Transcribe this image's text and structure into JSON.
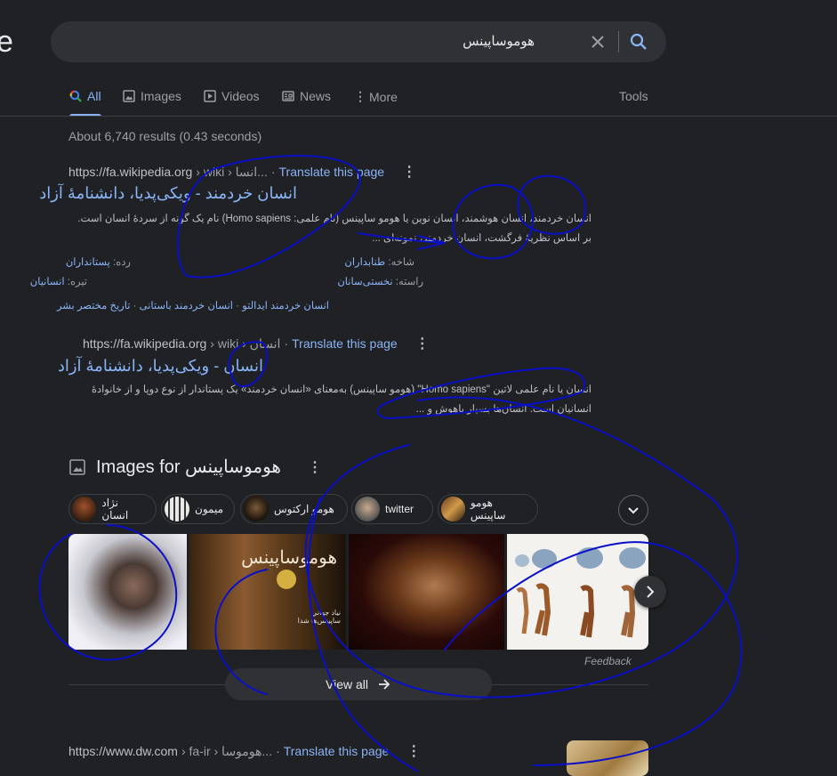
{
  "logo_fragment": "e",
  "search": {
    "query": "هوموساپینس",
    "clear_icon": "close-icon",
    "search_icon": "search-icon"
  },
  "tabs": [
    {
      "label": "All",
      "icon": "google-search-icon"
    },
    {
      "label": "Images",
      "icon": "image-icon"
    },
    {
      "label": "Videos",
      "icon": "video-icon"
    },
    {
      "label": "News",
      "icon": "news-icon"
    },
    {
      "label": "More",
      "icon": "more-vert-icon"
    }
  ],
  "tools_label": "Tools",
  "stats": "About 6,740 results (0.43 seconds)",
  "results": [
    {
      "domain": "https://fa.wikipedia.org",
      "path": " › wiki › انسا...",
      "translate": "Translate this page",
      "title": "انسان خردمند - ویکی‌پدیا، دانشنامهٔ آزاد",
      "snippet": "انسان خردمند، انسان هوشمند، انسان نوین یا هومو ساپینس (نام علمی: Homo sapiens) نام یک گونه از سردهٔ انسان است. بر اساس نظریهٔ فرگشت، انسان خردمند، نمونه‌ای ...",
      "attrs": [
        {
          "label": "رده:",
          "value": "پستانداران"
        },
        {
          "label": "شاخه:",
          "value": "طنابداران"
        },
        {
          "label": "تیره:",
          "value": "انسانیان"
        },
        {
          "label": "راسته:",
          "value": "نخستی‌سانان"
        }
      ],
      "sitelinks": [
        "انسان خردمند ایدالتو",
        "انسان خردمند باستانی",
        "تاریخ مختصر بشر"
      ]
    },
    {
      "domain": "https://fa.wikipedia.org",
      "path": " › wiki › انسان",
      "translate": "Translate this page",
      "title": "انسان - ویکی‌پدیا، دانشنامهٔ آزاد",
      "snippet": "انسان یا نام علمی لاتین \"Homo sapiens\" (هومو ساپینس) به‌معنای «انسان خردمند» یک پستاندار از نوع دوپا و از خانوادهٔ انسانیان است. انسان‌ها بسیار باهوش و ..."
    }
  ],
  "images_section": {
    "title": "Images for هوموساپینس",
    "chips": [
      "نژاد انسان",
      "میمون",
      "هومو ارکتوس",
      "twitter",
      "هومو ساپینس"
    ],
    "feedback": "Feedback",
    "view_all": "View all",
    "thumb_poster_text": "هوموساپینس",
    "thumb_poster_caption": "نياد جهاني\nساپینس‌ها شدا"
  },
  "result3": {
    "domain": "https://www.dw.com",
    "path": " › fa-ir › هوموسا...",
    "translate": "Translate this page"
  },
  "colors": {
    "bg": "#202124",
    "link": "#8ab4f8",
    "ink": "#0000cc"
  }
}
